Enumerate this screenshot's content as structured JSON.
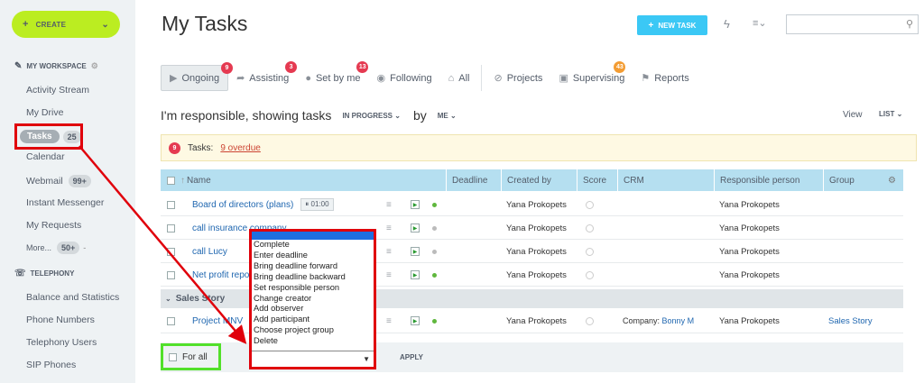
{
  "sidebar": {
    "create_label": "CREATE",
    "workspace_label": "MY WORKSPACE",
    "items": [
      {
        "label": "Activity Stream"
      },
      {
        "label": "My Drive"
      },
      {
        "label": "Tasks",
        "counter": "25"
      },
      {
        "label": "Calendar"
      },
      {
        "label": "Webmail",
        "counter": "99+"
      },
      {
        "label": "Instant Messenger"
      },
      {
        "label": "My Requests"
      },
      {
        "label": "More...",
        "counter": "50+"
      }
    ],
    "telephony_label": "TELEPHONY",
    "telephony_items": [
      {
        "label": "Balance and Statistics"
      },
      {
        "label": "Phone Numbers"
      },
      {
        "label": "Telephony Users"
      },
      {
        "label": "SIP Phones"
      }
    ]
  },
  "header": {
    "title": "My Tasks",
    "new_task_label": "NEW TASK",
    "search_placeholder": ""
  },
  "tabs": [
    {
      "label": "Ongoing",
      "badge": "9",
      "badge_color": "#e53a51"
    },
    {
      "label": "Assisting",
      "badge": "3",
      "badge_color": "#e53a51"
    },
    {
      "label": "Set by me",
      "badge": "13",
      "badge_color": "#e53a51"
    },
    {
      "label": "Following"
    },
    {
      "label": "All"
    },
    {
      "label": "Projects"
    },
    {
      "label": "Supervising",
      "badge": "43",
      "badge_color": "#f39c33"
    },
    {
      "label": "Reports"
    }
  ],
  "filter": {
    "prefix": "I'm responsible, showing tasks",
    "status": "IN PROGRESS",
    "by": "by",
    "who": "ME",
    "view_label": "View",
    "view_mode": "LIST"
  },
  "overdue": {
    "count": "9",
    "label": "Tasks:",
    "link": "9 overdue"
  },
  "table": {
    "columns": [
      "Name",
      "Deadline",
      "Created by",
      "Score",
      "CRM",
      "Responsible person",
      "Group"
    ],
    "rows": [
      {
        "name": "Board of directors (plans)",
        "timer": "01:00",
        "created_by": "Yana Prokopets",
        "crm": "",
        "responsible": "Yana Prokopets",
        "group": "",
        "status": "green"
      },
      {
        "name": "call insurance company",
        "created_by": "Yana Prokopets",
        "crm": "",
        "responsible": "Yana Prokopets",
        "group": "",
        "status": "gray"
      },
      {
        "name": "call Lucy",
        "created_by": "Yana Prokopets",
        "crm": "",
        "responsible": "Yana Prokopets",
        "group": "",
        "status": "gray"
      },
      {
        "name": "Net profit report",
        "created_by": "Yana Prokopets",
        "crm": "",
        "responsible": "Yana Prokopets",
        "group": "",
        "status": "green"
      }
    ],
    "group_title": "Sales Story",
    "group_rows": [
      {
        "name": "Project MNV",
        "created_by": "Yana Prokopets",
        "crm_prefix": "Company:",
        "crm": "Bonny M",
        "responsible": "Yana Prokopets",
        "group": "Sales Story",
        "status": "green"
      }
    ]
  },
  "footer": {
    "for_all_label": "For all",
    "apply_label": "APPLY"
  },
  "action_menu": {
    "options": [
      "Complete",
      "Enter deadline",
      "Bring deadline forward",
      "Bring deadline backward",
      "Set responsible person",
      "Change creator",
      "Add observer",
      "Add participant",
      "Choose project group",
      "Delete"
    ]
  },
  "colors": {
    "create_button": "#bbed21",
    "new_task_button": "#3bc8f5",
    "annotation_red": "#e0000b",
    "annotation_green": "#52e02a",
    "table_header": "#b5dff0"
  }
}
